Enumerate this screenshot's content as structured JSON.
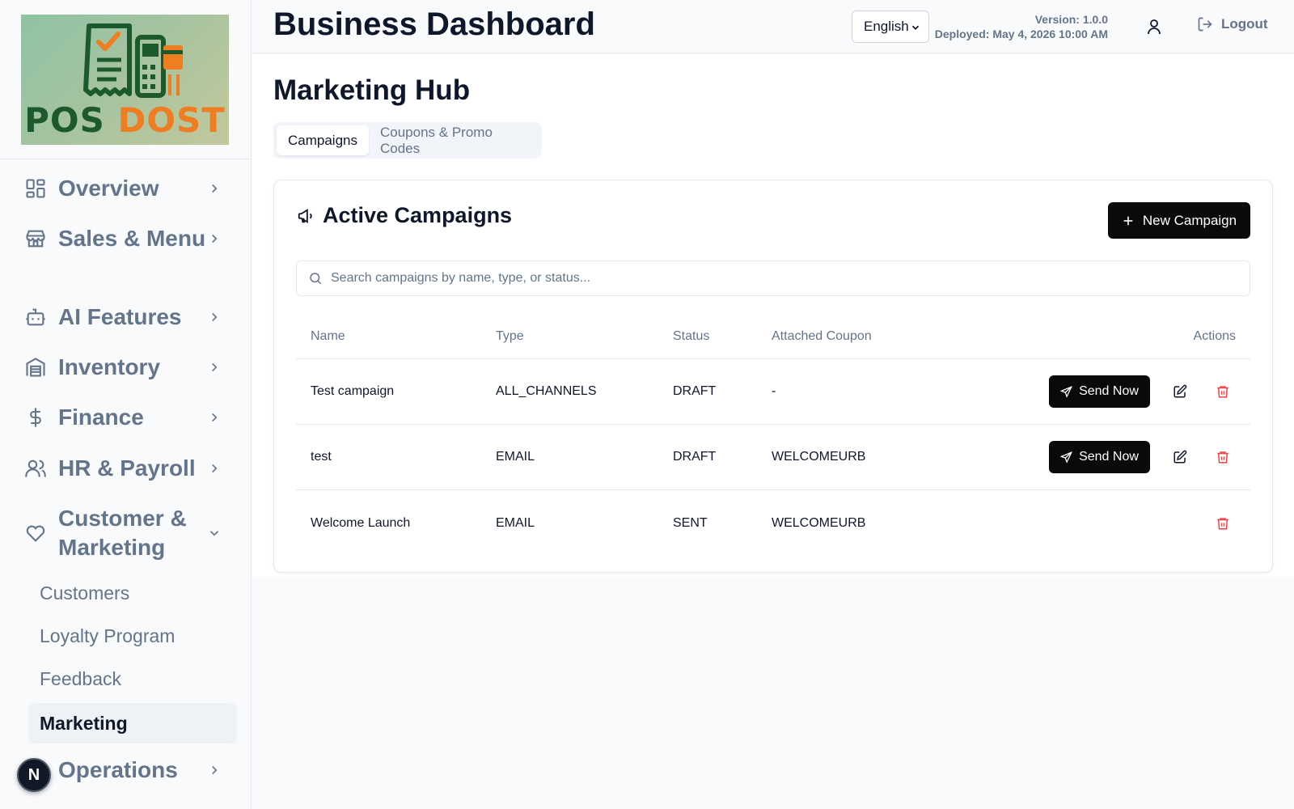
{
  "brand": {
    "logo_word_1": "POS",
    "logo_word_2": "DOST"
  },
  "sidebar": {
    "items": [
      {
        "label": "Overview",
        "icon": "layout-dashboard-icon"
      },
      {
        "label": "Sales & Menu",
        "icon": "store-icon"
      },
      {
        "label": "AI Features",
        "icon": "bot-icon"
      },
      {
        "label": "Inventory",
        "icon": "warehouse-icon"
      },
      {
        "label": "Finance",
        "icon": "dollar-icon"
      },
      {
        "label": "HR & Payroll",
        "icon": "users-icon"
      },
      {
        "label": "Customer & Marketing",
        "icon": "heart-icon",
        "expanded": true
      },
      {
        "label": "Operations",
        "icon": "operations-icon"
      }
    ],
    "subitems": [
      {
        "label": "Customers"
      },
      {
        "label": "Loyalty Program"
      },
      {
        "label": "Feedback"
      },
      {
        "label": "Marketing",
        "active": true
      }
    ],
    "badge_letter": "N"
  },
  "header": {
    "title": "Business Dashboard",
    "language": "English",
    "version": "Version: 1.0.0",
    "deployed": "Deployed: May 4, 2026 10:00 AM",
    "logout_label": "Logout"
  },
  "main": {
    "page_title": "Marketing Hub",
    "tabs": [
      {
        "label": "Campaigns",
        "active": true
      },
      {
        "label": "Coupons & Promo Codes",
        "active": false
      }
    ],
    "card": {
      "title": "Active Campaigns",
      "new_button": "New Campaign",
      "search_placeholder": "Search campaigns by name, type, or status...",
      "columns": [
        "Name",
        "Type",
        "Status",
        "Attached Coupon",
        "Actions"
      ],
      "send_label": "Send Now",
      "rows": [
        {
          "name": "Test campaign",
          "type": "ALL_CHANNELS",
          "status": "DRAFT",
          "coupon": "-",
          "can_send": true,
          "can_edit": true
        },
        {
          "name": "test",
          "type": "EMAIL",
          "status": "DRAFT",
          "coupon": "WELCOMEURB",
          "can_send": true,
          "can_edit": true
        },
        {
          "name": "Welcome Launch",
          "type": "EMAIL",
          "status": "SENT",
          "coupon": "WELCOMEURB",
          "can_send": false,
          "can_edit": false
        }
      ]
    }
  },
  "colors": {
    "accent": "#0a0a0a",
    "muted_text": "#64748b",
    "delete": "#ef4444",
    "logo_green": "#1c5a2d",
    "logo_orange": "#ef7d22"
  }
}
